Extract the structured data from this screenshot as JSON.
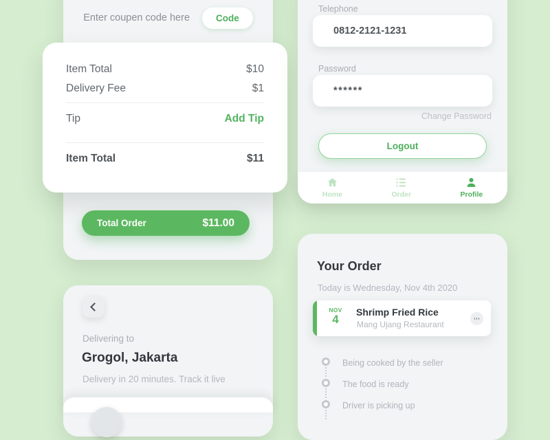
{
  "theme": {
    "background": "#d6edd0",
    "panel": "#f2f4f6",
    "accent_green": "#5cb860",
    "accent_green_text": "#4caf5a",
    "muted": "#b3b8bd"
  },
  "checkout": {
    "coupon": {
      "placeholder": "Enter coupen code here",
      "button_label": "Code"
    },
    "summary": {
      "rows": [
        {
          "label": "Item Total",
          "value": "$10"
        },
        {
          "label": "Delivery Fee",
          "value": "$1"
        },
        {
          "label": "Tip",
          "value": "Add Tip"
        },
        {
          "label": "Item Total",
          "value": "$11"
        }
      ]
    },
    "total_button": {
      "label": "Total Order",
      "amount": "$11.00"
    }
  },
  "delivery": {
    "back_icon": "chevron-left-icon",
    "delivering_to_label": "Delivering to",
    "address": "Grogol, Jakarta",
    "eta": "Delivery in 20 minutes. Track it live"
  },
  "profile": {
    "telephone": {
      "label": "Telephone",
      "value": "0812-2121-1231"
    },
    "password": {
      "label": "Password",
      "value": "******"
    },
    "change_password_link": "Change Password",
    "logout_label": "Logout",
    "nav": [
      {
        "label": "Home",
        "icon": "home-icon",
        "active": false
      },
      {
        "label": "Order",
        "icon": "list-icon",
        "active": false
      },
      {
        "label": "Profile",
        "icon": "person-icon",
        "active": true
      }
    ]
  },
  "order": {
    "title": "Your Order",
    "date_line": "Today is Wednesday, Nov 4th 2020",
    "item": {
      "badge_month": "NOV",
      "badge_day": "4",
      "name": "Shrimp Fried Rice",
      "restaurant": "Mang Ujang Restaurant",
      "menu_icon": "more-horizontal-icon"
    },
    "status_steps": [
      {
        "text": "Being cooked by the seller"
      },
      {
        "text": "The food is ready"
      },
      {
        "text": "Driver is picking up"
      }
    ]
  }
}
